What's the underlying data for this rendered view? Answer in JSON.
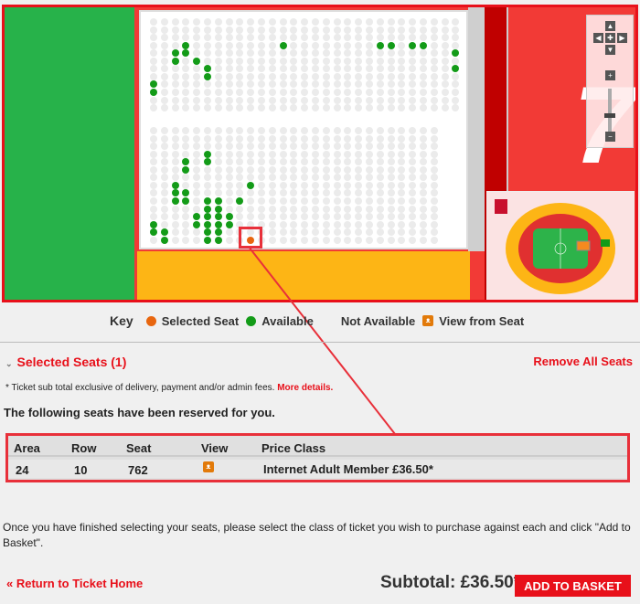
{
  "seat_map": {
    "top_block": {
      "rows": 12,
      "cols": 29,
      "available": [
        [
          3,
          3
        ],
        [
          3,
          12
        ],
        [
          3,
          21
        ],
        [
          3,
          22
        ],
        [
          3,
          24
        ],
        [
          3,
          25
        ],
        [
          4,
          2
        ],
        [
          4,
          3
        ],
        [
          4,
          28
        ],
        [
          5,
          2
        ],
        [
          5,
          4
        ],
        [
          6,
          5
        ],
        [
          6,
          28
        ],
        [
          7,
          5
        ],
        [
          8,
          0
        ],
        [
          9,
          0
        ]
      ]
    },
    "bottom_block": {
      "rows": 15,
      "cols": 27,
      "available": [
        [
          3,
          5
        ],
        [
          4,
          3
        ],
        [
          4,
          5
        ],
        [
          5,
          3
        ],
        [
          7,
          2
        ],
        [
          7,
          9
        ],
        [
          8,
          2
        ],
        [
          8,
          3
        ],
        [
          9,
          2
        ],
        [
          9,
          3
        ],
        [
          9,
          5
        ],
        [
          9,
          6
        ],
        [
          9,
          8
        ],
        [
          10,
          5
        ],
        [
          10,
          6
        ],
        [
          11,
          4
        ],
        [
          11,
          5
        ],
        [
          11,
          6
        ],
        [
          11,
          7
        ],
        [
          12,
          0
        ],
        [
          12,
          4
        ],
        [
          12,
          5
        ],
        [
          12,
          6
        ],
        [
          12,
          7
        ],
        [
          13,
          0
        ],
        [
          13,
          1
        ],
        [
          13,
          5
        ],
        [
          13,
          6
        ],
        [
          14,
          1
        ],
        [
          14,
          5
        ],
        [
          14,
          6
        ]
      ],
      "selected": [
        [
          14,
          9
        ]
      ]
    },
    "block_number": "7",
    "colors": {
      "available": "#139b18",
      "selected": "#e8660f",
      "not_available": "#ebebeb"
    }
  },
  "key": {
    "title": "Key",
    "selected": "Selected Seat",
    "available": "Available",
    "not_available": "Not Available",
    "view": "View from Seat"
  },
  "selected_seats": {
    "title": "Selected Seats (1)",
    "remove_all": "Remove All Seats"
  },
  "note": {
    "text": "* Ticket sub total exclusive of delivery, payment and/or admin fees. ",
    "link": "More details."
  },
  "reserved_text": "The following seats have been reserved for you.",
  "table": {
    "headers": [
      "Area",
      "Row",
      "Seat",
      "View",
      "Price Class"
    ],
    "rows": [
      {
        "area": "24",
        "row": "10",
        "seat": "762",
        "price_class": "Internet Adult Member £36.50*"
      }
    ]
  },
  "instructions": "Once you have finished selecting your seats, please select the class of ticket you wish to purchase against each and click \"Add to Basket\".",
  "return_link": "« Return to Ticket Home",
  "subtotal": "Subtotal: £36.50*",
  "add_to_basket": "ADD TO BASKET"
}
